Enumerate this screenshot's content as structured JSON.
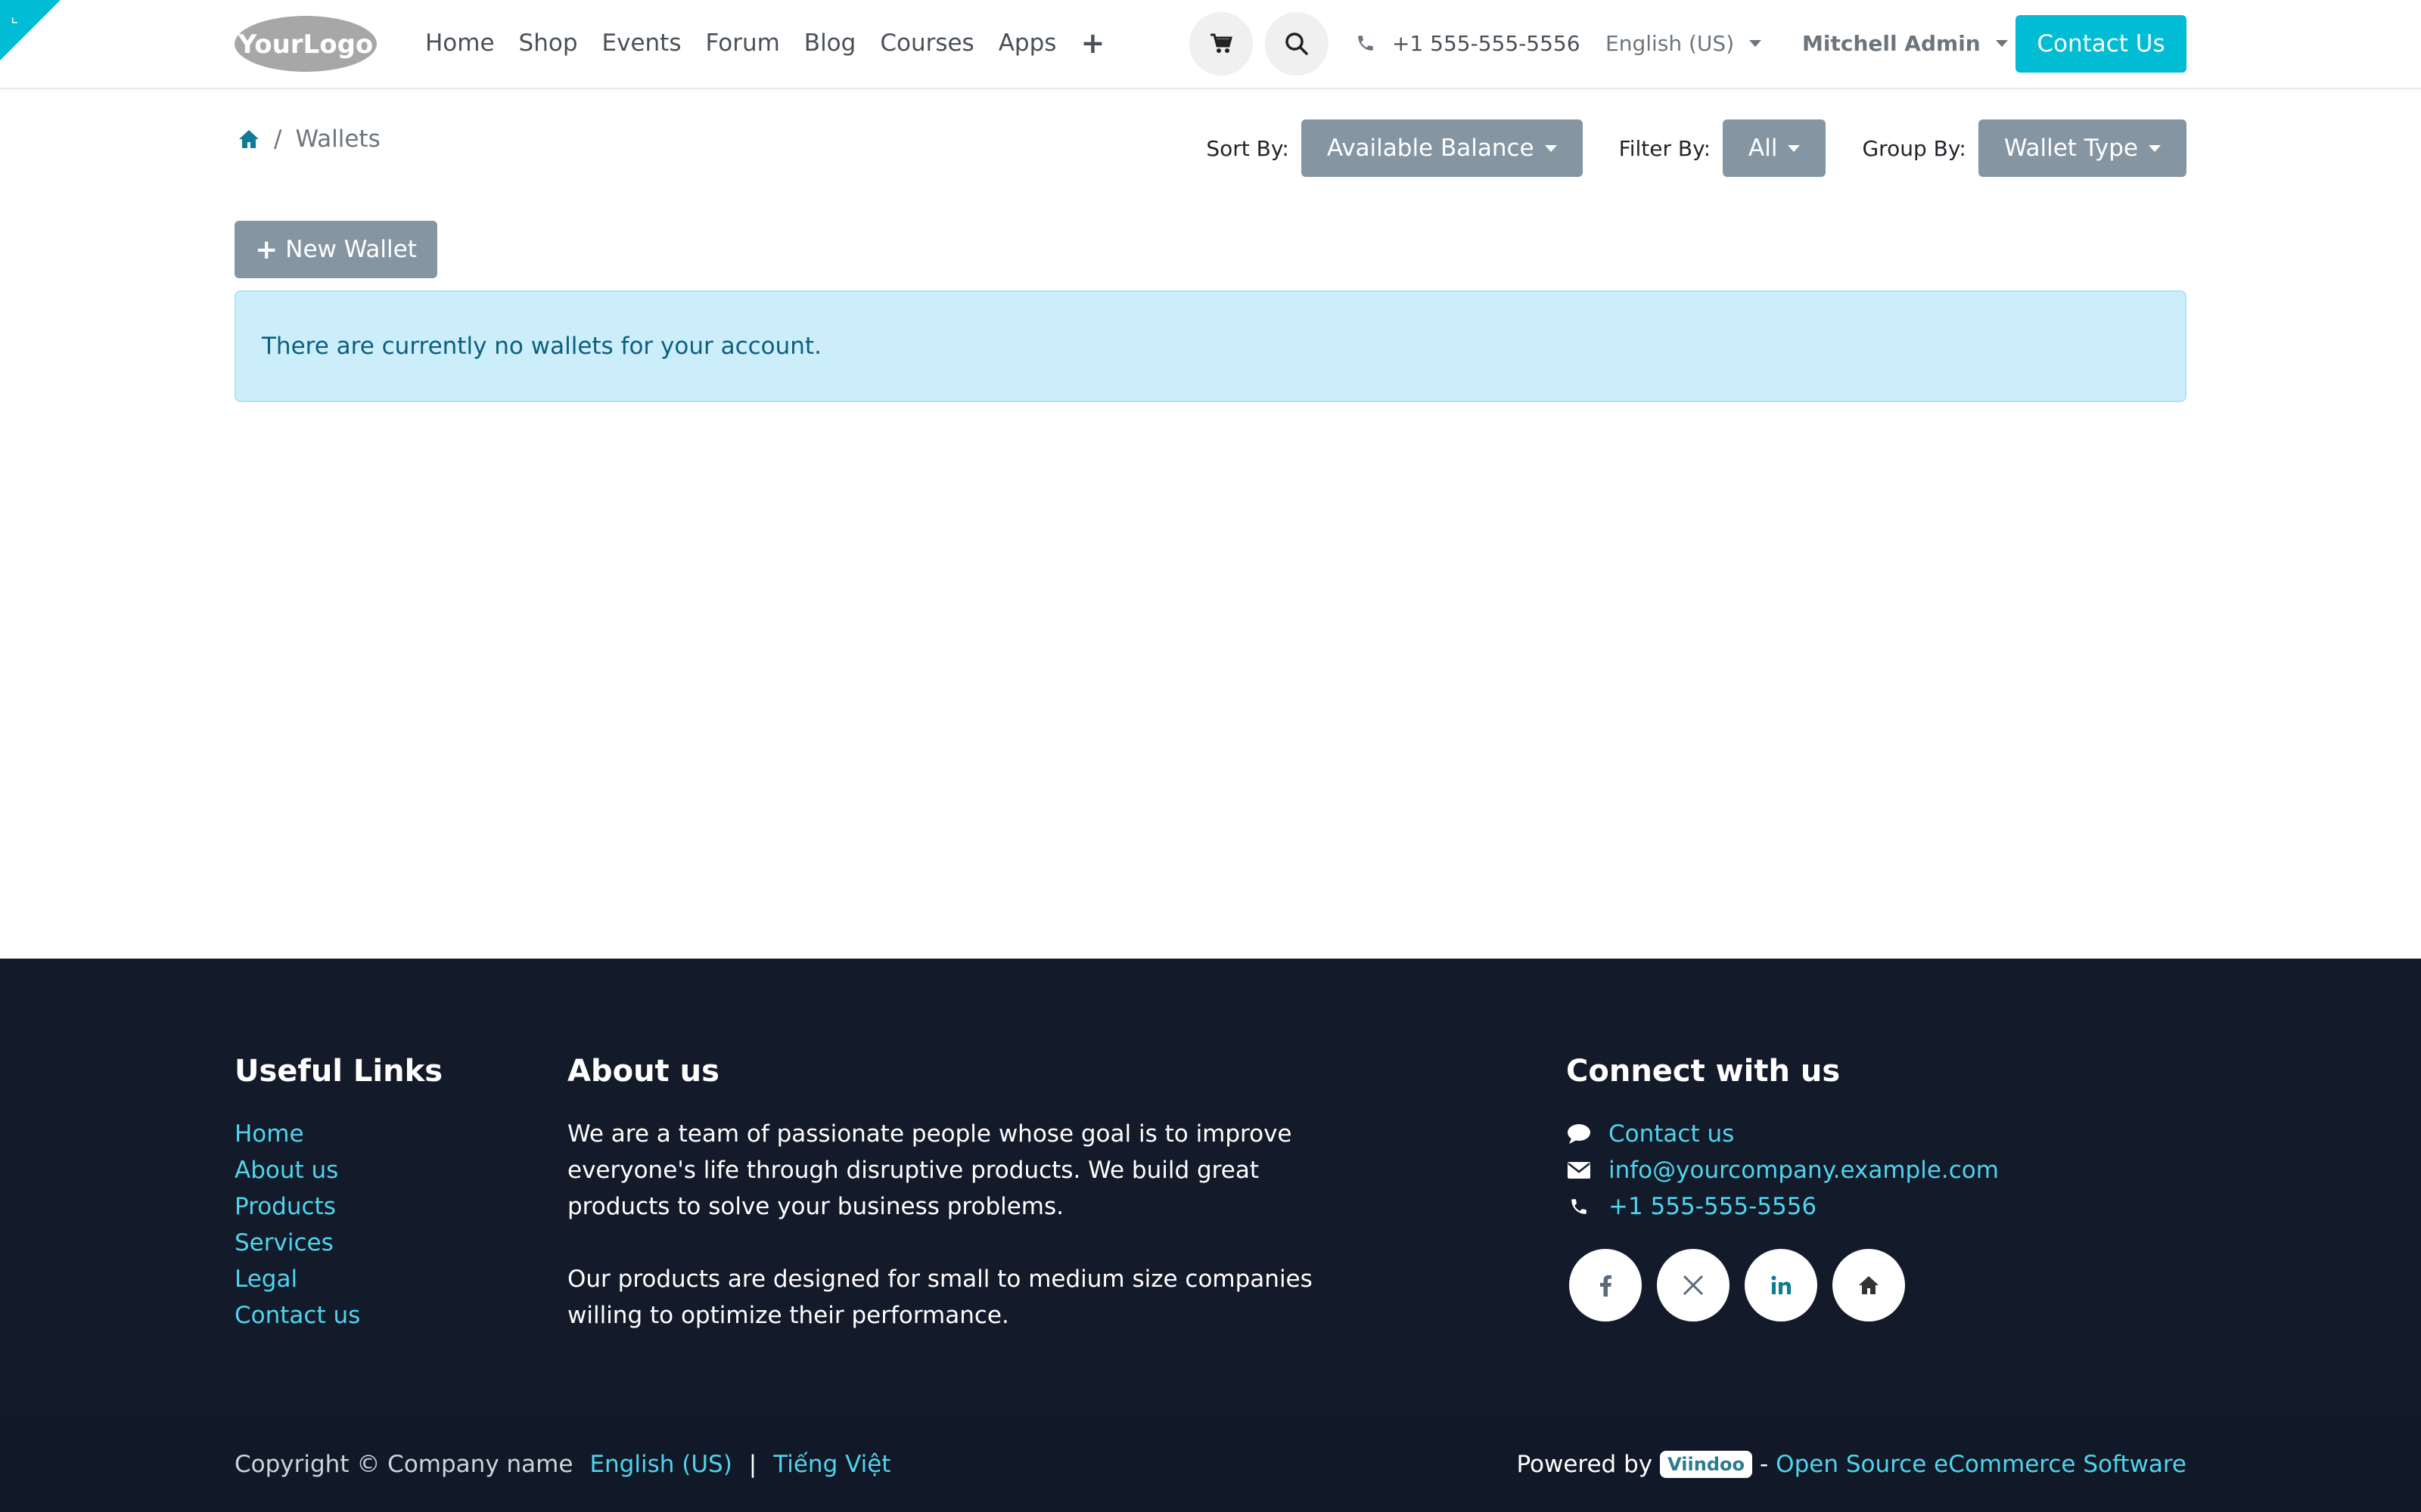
{
  "header": {
    "logo_text": "YourLogo",
    "nav": [
      "Home",
      "Shop",
      "Events",
      "Forum",
      "Blog",
      "Courses",
      "Apps"
    ],
    "nav_add_symbol": "+",
    "phone": "+1 555-555-5556",
    "language": "English (US)",
    "user": "Mitchell Admin",
    "contact_button": "Contact Us"
  },
  "breadcrumb": {
    "current": "Wallets"
  },
  "toolbar": {
    "sort_label": "Sort By:",
    "sort_value": "Available Balance",
    "filter_label": "Filter By:",
    "filter_value": "All",
    "group_label": "Group By:",
    "group_value": "Wallet Type"
  },
  "actions": {
    "new_wallet": "New Wallet"
  },
  "alert": {
    "message": "There are currently no wallets for your account."
  },
  "footer": {
    "useful_links_title": "Useful Links",
    "useful_links": [
      "Home",
      "About us",
      "Products",
      "Services",
      "Legal",
      "Contact us"
    ],
    "about_title": "About us",
    "about_p1": "We are a team of passionate people whose goal is to improve everyone's life through disruptive products. We build great products to solve your business problems.",
    "about_p2": "Our products are designed for small to medium size companies willing to optimize their performance.",
    "connect_title": "Connect with us",
    "connect_contact": "Contact us",
    "connect_email": "info@yourcompany.example.com",
    "connect_phone": "+1 555-555-5556",
    "socials": [
      "facebook-icon",
      "x-twitter-icon",
      "linkedin-icon",
      "home-icon"
    ]
  },
  "copyright": {
    "text": "Copyright © Company name",
    "lang_1": "English (US)",
    "separator": "|",
    "lang_2": "Tiếng Việt",
    "powered_by": "Powered by",
    "brand": "Viindoo",
    "dash": "-",
    "software_link": "Open Source eCommerce Software"
  },
  "colors": {
    "accent": "#00bcd4",
    "button_gray": "#8595a2",
    "footer_bg": "#131a2a",
    "link": "#4fd4ec"
  }
}
